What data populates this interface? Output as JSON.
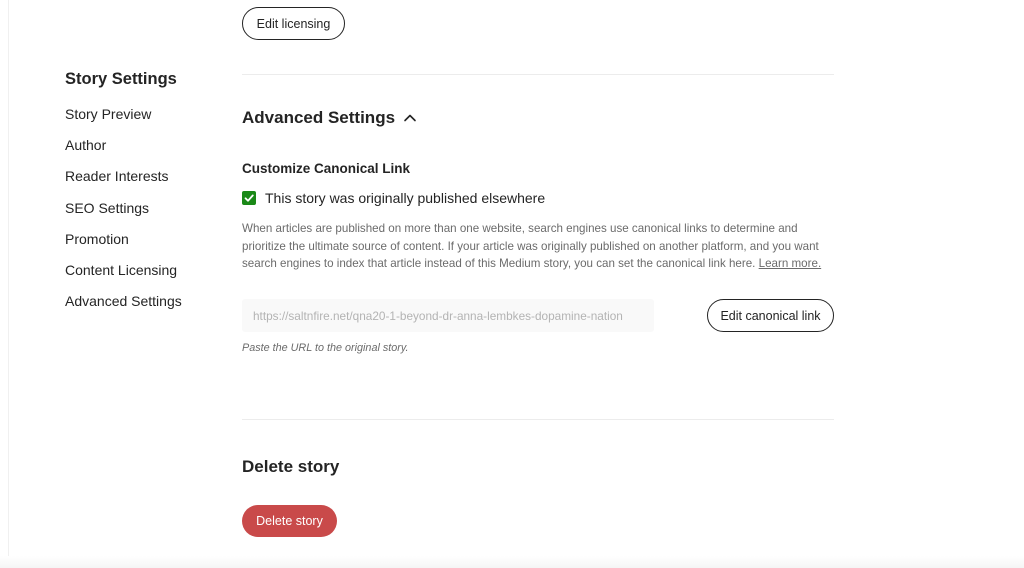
{
  "sidebar": {
    "title": "Story Settings",
    "items": [
      {
        "label": "Story Preview"
      },
      {
        "label": "Author"
      },
      {
        "label": "Reader Interests"
      },
      {
        "label": "SEO Settings"
      },
      {
        "label": "Promotion"
      },
      {
        "label": "Content Licensing"
      },
      {
        "label": "Advanced Settings"
      }
    ]
  },
  "licensing": {
    "edit_label": "Edit licensing"
  },
  "advanced": {
    "title": "Advanced Settings",
    "toggle_icon": "chevron-up-icon",
    "canonical": {
      "title": "Customize Canonical Link",
      "checkbox_label": "This story was originally published elsewhere",
      "checked": true,
      "description": "When articles are published on more than one website, search engines use canonical links to determine and prioritize the ultimate source of content. If your article was originally published on another platform, and you want search engines to index that article instead of this Medium story, you can set the canonical link here.",
      "learn_more": "Learn more.",
      "url_value": "https://saltnfire.net/qna20-1-beyond-dr-anna-lembkes-dopamine-nation",
      "edit_label": "Edit canonical link",
      "hint": "Paste the URL to the original story."
    }
  },
  "delete": {
    "title": "Delete story",
    "button_label": "Delete story"
  },
  "colors": {
    "accent_green": "#1a8917",
    "delete_red": "#c94a4a",
    "text": "#242424",
    "muted": "#6b6b6b"
  }
}
